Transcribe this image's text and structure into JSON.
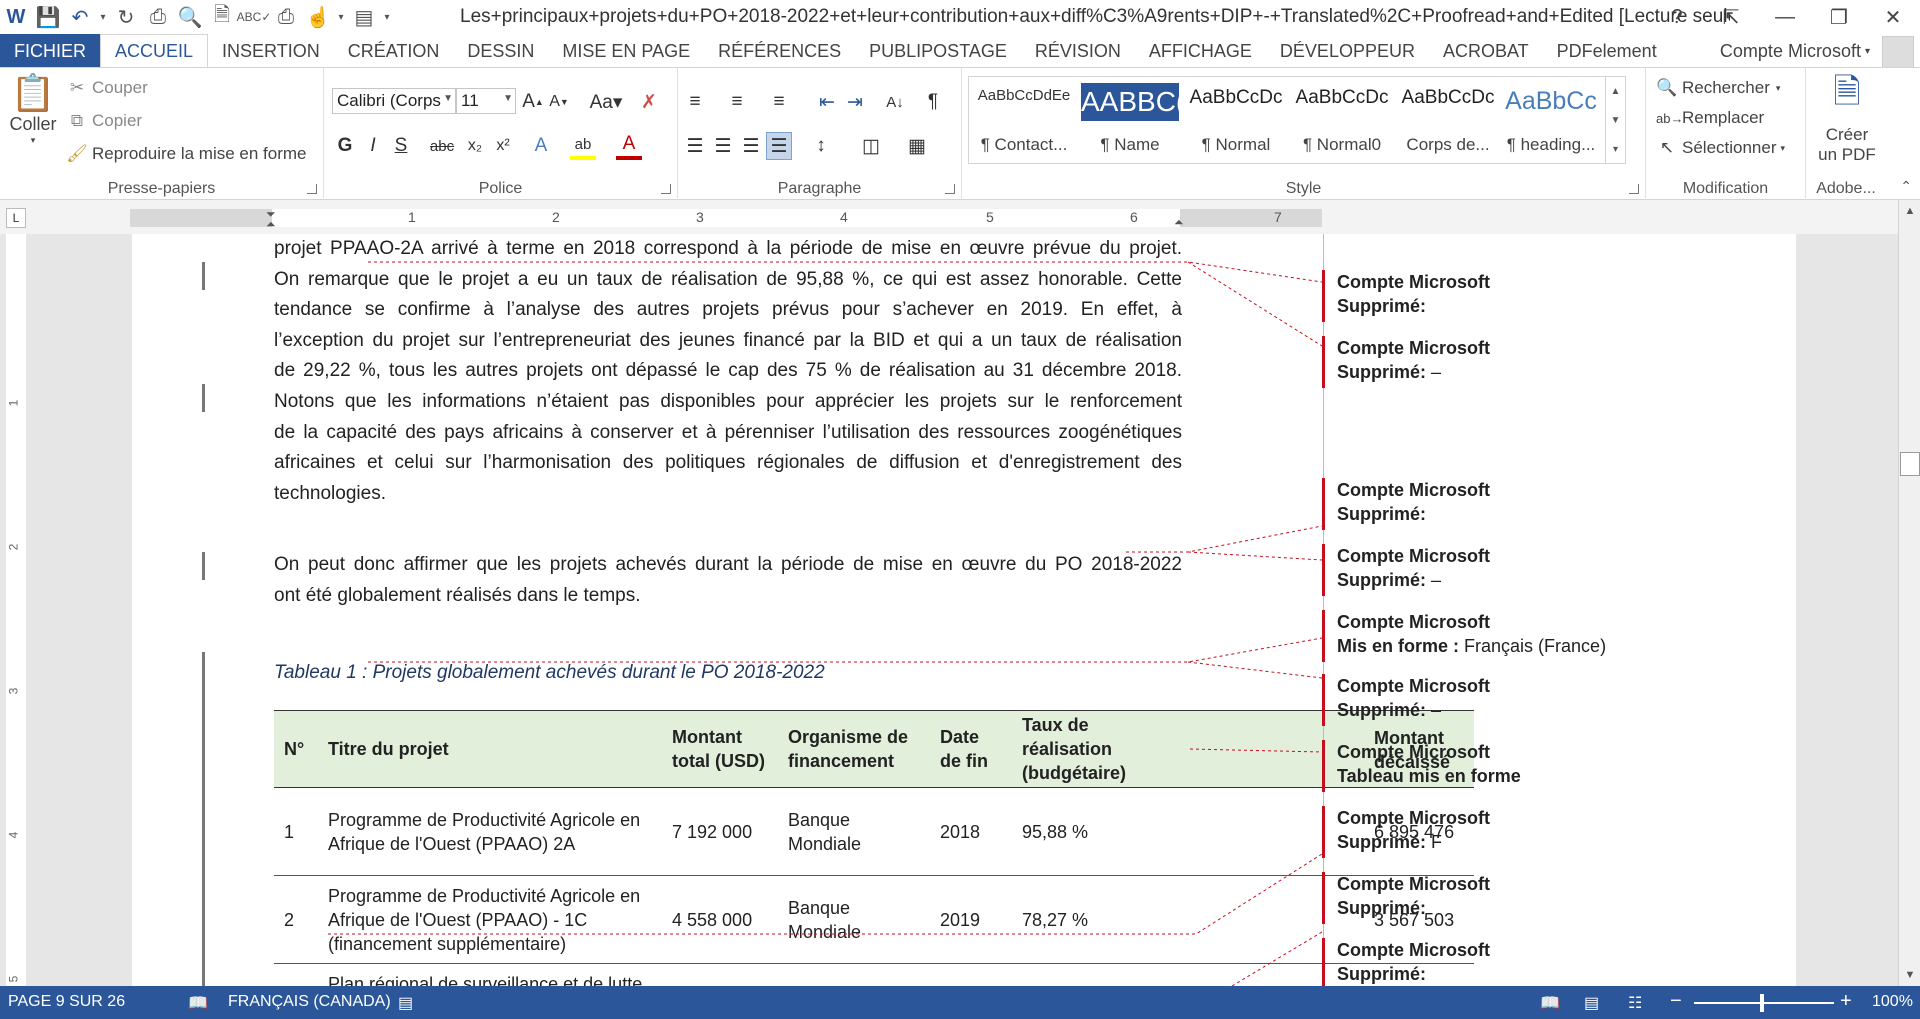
{
  "title": "Les+principaux+projets+du+PO+2018-2022+et+leur+contribution+aux+diff%C3%A9rents+DIP+-+Translated%2C+Proofread+and+Edited [Lecture seule] - W...",
  "window_controls": {
    "help": "?",
    "restore_ribbon": "⇱",
    "minimize": "—",
    "maximize": "❐",
    "close": "✕"
  },
  "tabs": [
    "FICHIER",
    "ACCUEIL",
    "INSERTION",
    "CRÉATION",
    "DESSIN",
    "MISE EN PAGE",
    "RÉFÉRENCES",
    "PUBLIPOSTAGE",
    "RÉVISION",
    "AFFICHAGE",
    "DÉVELOPPEUR",
    "ACROBAT",
    "PDFelement"
  ],
  "account": "Compte Microsoft",
  "ribbon": {
    "clipboard": {
      "label": "Presse-papiers",
      "paste": "Coller",
      "cut": "Couper",
      "copy": "Copier",
      "format_painter": "Reproduire la mise en forme"
    },
    "font": {
      "label": "Police",
      "font_name": "Calibri (Corps",
      "font_size": "11",
      "bold": "G",
      "italic": "I",
      "underline": "S",
      "strike": "abc",
      "subscript": "x₂",
      "superscript": "x²"
    },
    "paragraph": {
      "label": "Paragraphe"
    },
    "styles": {
      "label": "Style",
      "items": [
        {
          "sample": "AaBbCcDdEe",
          "name": "¶ Contact..."
        },
        {
          "sample": "AABBC(",
          "name": "¶ Name"
        },
        {
          "sample": "AaBbCcDc",
          "name": "¶ Normal"
        },
        {
          "sample": "AaBbCcDc",
          "name": "¶ Normal0"
        },
        {
          "sample": "AaBbCcDc",
          "name": "Corps de..."
        },
        {
          "sample": "AaBbCc",
          "name": "¶ heading..."
        }
      ]
    },
    "editing": {
      "label": "Modification",
      "find": "Rechercher",
      "replace": "Remplacer",
      "select": "Sélectionner"
    },
    "adobe": {
      "label": "Adobe...",
      "create_pdf_1": "Créer",
      "create_pdf_2": "un PDF"
    }
  },
  "ruler": {
    "numbers": [
      "1",
      "2",
      "3",
      "4",
      "5",
      "6",
      "7"
    ],
    "vnumbers": [
      "1",
      "2",
      "3",
      "4",
      "5"
    ]
  },
  "document": {
    "para1": [
      "projet PPAAO-2A arrivé à terme en 2018 correspond à la période de mise en œuvre prévue du projet.",
      "On remarque que le projet a eu un taux de réalisation de 95,88 %, ce qui est assez honorable. Cette",
      "tendance se confirme à l’analyse des autres projets prévus pour s’achever en 2019. En effet, à",
      "l’exception du projet sur l’entrepreneuriat des jeunes financé par la BID et qui a un taux de réalisation",
      "de 29,22 %, tous les autres projets ont dépassé le cap des 75 % de réalisation au 31 décembre 2018.",
      "Notons que les informations n’étaient pas disponibles pour apprécier les projets sur le renforcement",
      "de la capacité des pays africains à conserver et à pérenniser l’utilisation des ressources zoogénétiques",
      "africaines et celui sur l’harmonisation des politiques régionales de diffusion et d'enregistrement des",
      "technologies."
    ],
    "para2": [
      "On peut donc affirmer que les projets achevés durant la période de mise en œuvre du PO 2018-2022",
      "ont été globalement réalisés dans le temps."
    ],
    "caption": "Tableau 1 : Projets globalement achevés durant le PO 2018-2022",
    "table": {
      "headers": {
        "num": "N°",
        "title": "Titre du projet",
        "amount_1": "Montant",
        "amount_2": "total (USD)",
        "org_1": "Organisme de",
        "org_2": "financement",
        "end_1": "Date",
        "end_2": "de fin",
        "rate_1": "Taux de",
        "rate_2": "réalisation",
        "rate_3": "(budgétaire)"
      },
      "rows": [
        {
          "num": "1",
          "title_1": "Programme de Productivité Agricole en",
          "title_2": "Afrique de l'Ouest (PPAAO) 2A",
          "title_3": "",
          "amount": "7 192 000",
          "org_1": "Banque",
          "org_2": "Mondiale",
          "end": "2018",
          "rate": "95,88 %"
        },
        {
          "num": "2",
          "title_1": "Programme de Productivité Agricole en",
          "title_2": "Afrique de l'Ouest (PPAAO) - 1C",
          "title_3": "(financement supplémentaire)",
          "amount": "4 558 000",
          "org_1": "Banque",
          "org_2": "Mondiale",
          "end": "2019",
          "rate": "78,27 %"
        }
      ],
      "row3_partial": "Plan régional de surveillance et de lutte"
    },
    "ghost_text": {
      "header_1": "Montant",
      "header_2": "décaissé",
      "val1": "6 895 476",
      "val2": "3 567 503"
    }
  },
  "comments": [
    {
      "author": "Compte Microsoft",
      "action": "Supprimé:",
      "detail": ""
    },
    {
      "author": "Compte Microsoft",
      "action": "Supprimé:",
      "detail": " –"
    },
    {
      "author": "Compte Microsoft",
      "action": "Supprimé:",
      "detail": ""
    },
    {
      "author": "Compte Microsoft",
      "action": "Supprimé:",
      "detail": " –"
    },
    {
      "author": "Compte Microsoft",
      "action": "Mis en forme :",
      "detail": " Français (France)"
    },
    {
      "author": "Compte Microsoft",
      "action": "Supprimé:",
      "detail": "  –"
    },
    {
      "author": "Compte Microsoft",
      "action": "Tableau mis en forme",
      "detail": ""
    },
    {
      "author": "Compte Microsoft",
      "action": "Supprimé:",
      "detail": " F"
    },
    {
      "author": "Compte Microsoft",
      "action": "Supprimé:",
      "detail": ""
    },
    {
      "author": "Compte Microsoft",
      "action": "Supprimé:",
      "detail": ""
    }
  ],
  "status": {
    "page": "PAGE 9 SUR 26",
    "language": "FRANÇAIS (CANADA)",
    "zoom": "100%",
    "zoom_minus": "−",
    "zoom_plus": "+"
  },
  "colors": {
    "accent": "#2b579a",
    "revision": "#c50f1f",
    "table_header": "#e2efda"
  }
}
